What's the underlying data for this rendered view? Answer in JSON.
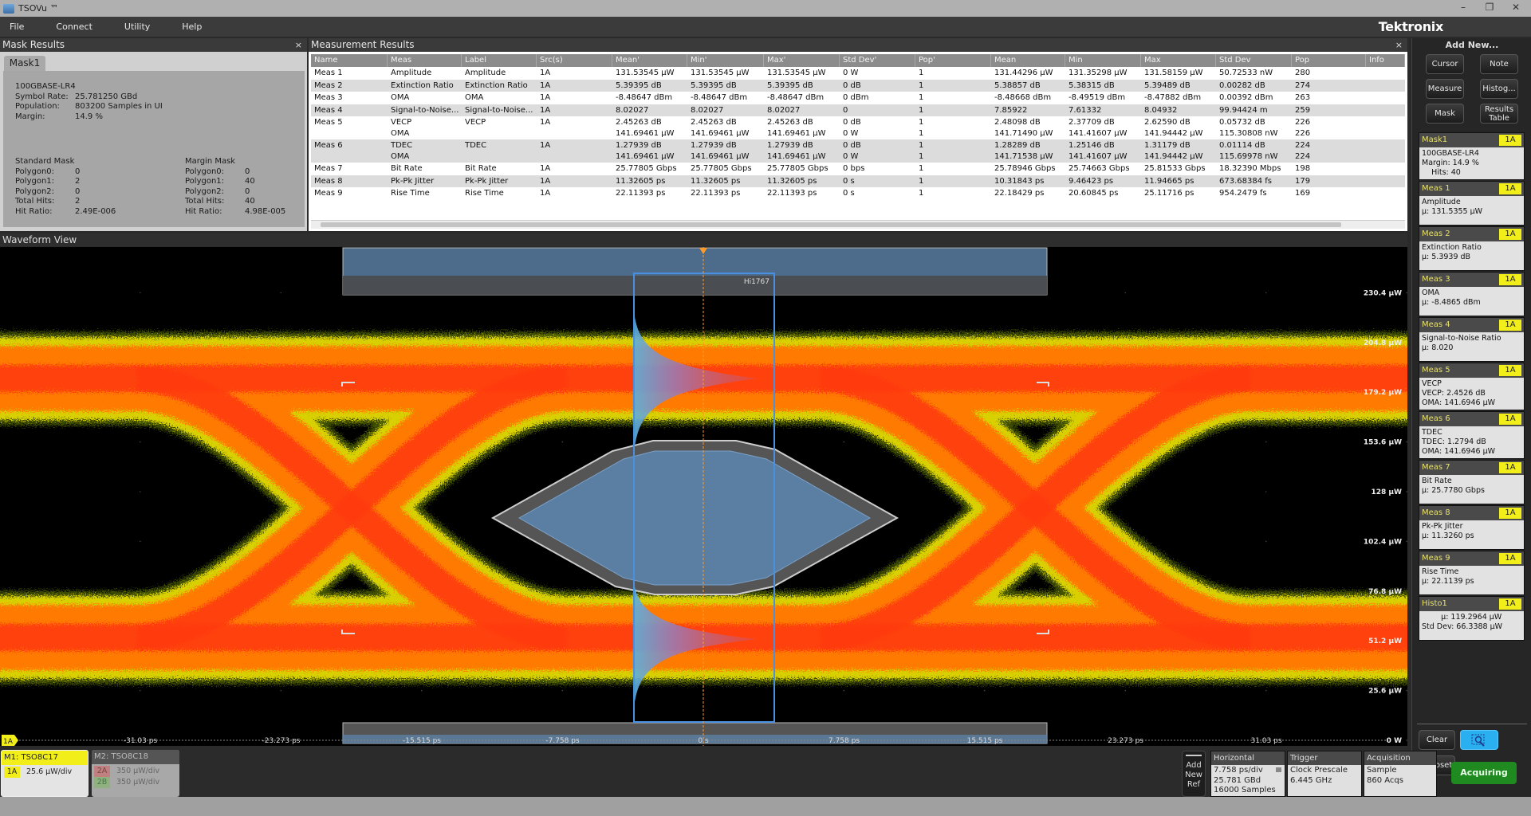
{
  "window": {
    "title": "TSOVu ™",
    "minimize": "–",
    "restore": "❐",
    "close": "✕"
  },
  "menu": [
    "File",
    "Connect",
    "Utility",
    "Help"
  ],
  "brand": "Tektronix",
  "mask_results": {
    "title": "Mask Results",
    "close": "×",
    "tab": "Mask1",
    "standard": "100GBASE-LR4",
    "info": [
      [
        "Symbol Rate:",
        "25.781250 GBd"
      ],
      [
        "Population:",
        "803200 Samples in UI"
      ],
      [
        "Margin:",
        "14.9 %"
      ]
    ],
    "standard_mask": {
      "title": "Standard Mask",
      "rows": [
        [
          "Polygon0:",
          "0"
        ],
        [
          "Polygon1:",
          "2"
        ],
        [
          "Polygon2:",
          "0"
        ],
        [
          "Total Hits:",
          "2"
        ],
        [
          "Hit Ratio:",
          "2.49E-006"
        ]
      ]
    },
    "margin_mask": {
      "title": "Margin Mask",
      "rows": [
        [
          "Polygon0:",
          "0"
        ],
        [
          "Polygon1:",
          "40"
        ],
        [
          "Polygon2:",
          "0"
        ],
        [
          "Total Hits:",
          "40"
        ],
        [
          "Hit Ratio:",
          "4.98E-005"
        ]
      ]
    }
  },
  "measurement_results": {
    "title": "Measurement Results",
    "close": "×",
    "columns": [
      "Name",
      "Meas",
      "Label",
      "Src(s)",
      "Mean'",
      "Min'",
      "Max'",
      "Std Dev'",
      "Pop'",
      "Mean",
      "Min",
      "Max",
      "Std Dev",
      "Pop",
      "Info"
    ],
    "rows": [
      {
        "name": "Meas 1",
        "lines": [
          [
            "Amplitude",
            "Amplitude",
            "1A",
            "131.53545 μW",
            "131.53545 μW",
            "131.53545 μW",
            "0 W",
            "1",
            "131.44296 μW",
            "131.35298 μW",
            "131.58159 μW",
            "50.72533 nW",
            "280",
            ""
          ]
        ]
      },
      {
        "name": "Meas 2",
        "lines": [
          [
            "Extinction Ratio",
            "Extinction Ratio",
            "1A",
            "5.39395 dB",
            "5.39395 dB",
            "5.39395 dB",
            "0 dB",
            "1",
            "5.38857 dB",
            "5.38315 dB",
            "5.39489 dB",
            "0.00282 dB",
            "274",
            ""
          ]
        ]
      },
      {
        "name": "Meas 3",
        "lines": [
          [
            "OMA",
            "OMA",
            "1A",
            "-8.48647 dBm",
            "-8.48647 dBm",
            "-8.48647 dBm",
            "0 dBm",
            "1",
            "-8.48668 dBm",
            "-8.49519 dBm",
            "-8.47882 dBm",
            "0.00392 dBm",
            "263",
            ""
          ]
        ]
      },
      {
        "name": "Meas 4",
        "lines": [
          [
            "Signal-to-Noise...",
            "Signal-to-Noise...",
            "1A",
            "8.02027",
            "8.02027",
            "8.02027",
            "0",
            "1",
            "7.85922",
            "7.61332",
            "8.04932",
            "99.94424 m",
            "259",
            ""
          ]
        ]
      },
      {
        "name": "Meas 5",
        "lines": [
          [
            "VECP",
            "VECP",
            "1A",
            "2.45263 dB",
            "2.45263 dB",
            "2.45263 dB",
            "0 dB",
            "1",
            "2.48098 dB",
            "2.37709 dB",
            "2.62590 dB",
            "0.05732 dB",
            "226",
            ""
          ],
          [
            "OMA",
            "",
            "",
            "141.69461 μW",
            "141.69461 μW",
            "141.69461 μW",
            "0 W",
            "1",
            "141.71490 μW",
            "141.41607 μW",
            "141.94442 μW",
            "115.30808 nW",
            "226",
            ""
          ]
        ]
      },
      {
        "name": "Meas 6",
        "lines": [
          [
            "TDEC",
            "TDEC",
            "1A",
            "1.27939 dB",
            "1.27939 dB",
            "1.27939 dB",
            "0 dB",
            "1",
            "1.28289 dB",
            "1.25146 dB",
            "1.31179 dB",
            "0.01114 dB",
            "224",
            ""
          ],
          [
            "OMA",
            "",
            "",
            "141.69461 μW",
            "141.69461 μW",
            "141.69461 μW",
            "0 W",
            "1",
            "141.71538 μW",
            "141.41607 μW",
            "141.94442 μW",
            "115.69978 nW",
            "224",
            ""
          ]
        ]
      },
      {
        "name": "Meas 7",
        "lines": [
          [
            "Bit Rate",
            "Bit Rate",
            "1A",
            "25.77805 Gbps",
            "25.77805 Gbps",
            "25.77805 Gbps",
            "0 bps",
            "1",
            "25.78946 Gbps",
            "25.74663 Gbps",
            "25.81533 Gbps",
            "18.32390 Mbps",
            "198",
            ""
          ]
        ]
      },
      {
        "name": "Meas 8",
        "lines": [
          [
            "Pk-Pk Jitter",
            "Pk-Pk Jitter",
            "1A",
            "11.32605 ps",
            "11.32605 ps",
            "11.32605 ps",
            "0 s",
            "1",
            "10.31843 ps",
            "9.46423 ps",
            "11.94665 ps",
            "673.68384 fs",
            "179",
            ""
          ]
        ]
      },
      {
        "name": "Meas 9",
        "lines": [
          [
            "Rise Time",
            "Rise Time",
            "1A",
            "22.11393 ps",
            "22.11393 ps",
            "22.11393 ps",
            "0 s",
            "1",
            "22.18429 ps",
            "20.60845 ps",
            "25.11716 ps",
            "954.2479 fs",
            "169",
            ""
          ]
        ]
      }
    ]
  },
  "waveform": {
    "title": "Waveform View",
    "y_labels": [
      "230.4 μW",
      "204.8 μW",
      "179.2 μW",
      "153.6 μW",
      "128 μW",
      "102.4 μW",
      "76.8 μW",
      "51.2 μW",
      "25.6 μW",
      "0 W"
    ],
    "x_labels": [
      "-31.03 ps",
      "-23.273 ps",
      "-15.515 ps",
      "-7.758 ps",
      "0 s",
      "7.758 ps",
      "15.515 ps",
      "23.273 ps",
      "31.03 ps"
    ],
    "channel_marker": "1A",
    "histogram_label": "Hi1767",
    "colors": {
      "trace_core": "#ff3a10",
      "trace_mid": "#ff7a00",
      "trace_edge": "#d8d000",
      "mask": "#5b7fa3",
      "histogram": "#9a6fb0",
      "cursor": "#ff9a2a"
    }
  },
  "right_panel": {
    "add_new": "Add New...",
    "buttons": [
      "Cursor",
      "Note",
      "Measure",
      "Histog...",
      "Mask",
      "Results Table"
    ],
    "cards": [
      {
        "title": "Mask1",
        "src": "1A",
        "lines": [
          "100GBASE-LR4",
          "Margin: 14.9 %",
          "    Hits: 40"
        ]
      },
      {
        "title": "Meas 1",
        "src": "1A",
        "lines": [
          "Amplitude",
          "μ: 131.5355 μW"
        ]
      },
      {
        "title": "Meas 2",
        "src": "1A",
        "lines": [
          "Extinction Ratio",
          "μ: 5.3939 dB"
        ]
      },
      {
        "title": "Meas 3",
        "src": "1A",
        "lines": [
          "OMA",
          "μ: -8.4865 dBm"
        ]
      },
      {
        "title": "Meas 4",
        "src": "1A",
        "lines": [
          "Signal-to-Noise Ratio",
          "μ: 8.020"
        ]
      },
      {
        "title": "Meas 5",
        "src": "1A",
        "lines": [
          "VECP",
          "VECP: 2.4526 dB",
          "OMA: 141.6946 μW"
        ]
      },
      {
        "title": "Meas 6",
        "src": "1A",
        "lines": [
          "TDEC",
          "TDEC: 1.2794 dB",
          "OMA: 141.6946 μW"
        ]
      },
      {
        "title": "Meas 7",
        "src": "1A",
        "lines": [
          "Bit Rate",
          "μ: 25.7780 Gbps"
        ]
      },
      {
        "title": "Meas 8",
        "src": "1A",
        "lines": [
          "Pk-Pk Jitter",
          "μ: 11.3260 ps"
        ]
      },
      {
        "title": "Meas 9",
        "src": "1A",
        "lines": [
          "Rise Time",
          "μ: 22.1139 ps"
        ]
      },
      {
        "title": "Histo1",
        "src": "1A",
        "lines": [
          "        μ: 119.2964 μW",
          "Std Dev: 66.3388 μW"
        ]
      }
    ],
    "clear": "Clear",
    "autoset": "Autoset"
  },
  "bottom": {
    "m1": {
      "title": "M1: TSO8C17",
      "chan": "1A",
      "scale": "25.6 μW/div"
    },
    "m2": {
      "title": "M2: TSO8C18",
      "rows": [
        [
          "2A",
          "350 μW/div"
        ],
        [
          "2B",
          "350 μW/div"
        ]
      ]
    },
    "add_ref": "Add New Ref",
    "horizontal": {
      "title": "Horizontal",
      "lines": [
        "7.758 ps/div",
        "25.781 GBd",
        "16000 Samples"
      ]
    },
    "trigger": {
      "title": "Trigger",
      "lines": [
        "Clock Prescale",
        "6.445 GHz"
      ]
    },
    "acquisition": {
      "title": "Acquisition",
      "lines": [
        "Sample",
        "860 Acqs"
      ]
    },
    "acquiring": "Acquiring"
  }
}
